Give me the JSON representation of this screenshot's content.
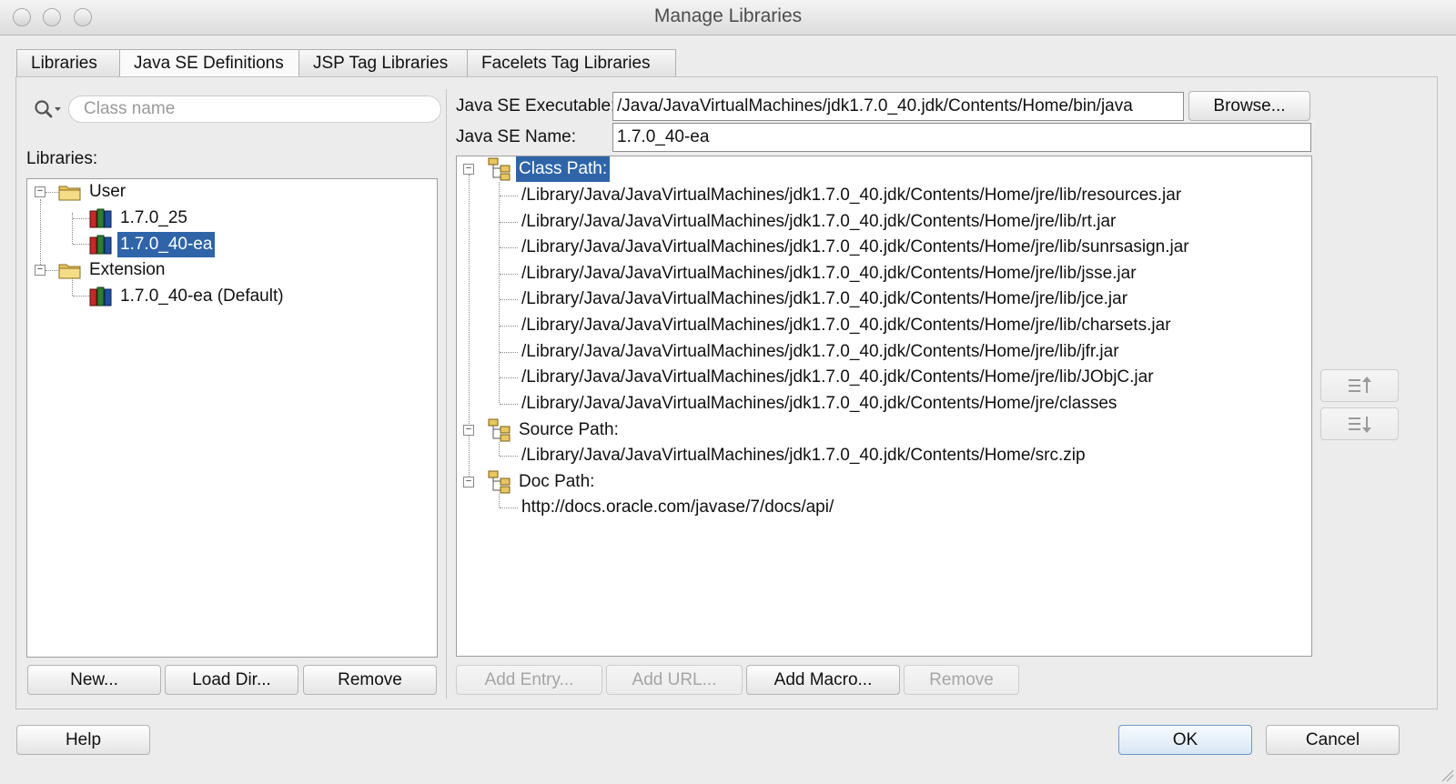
{
  "window": {
    "title": "Manage Libraries"
  },
  "tabs": [
    {
      "label": "Libraries"
    },
    {
      "label": "Java SE Definitions"
    },
    {
      "label": "JSP Tag Libraries"
    },
    {
      "label": "Facelets Tag Libraries"
    }
  ],
  "active_tab": "Java SE Definitions",
  "search": {
    "placeholder": "Class name",
    "value": ""
  },
  "libraries": {
    "label": "Libraries:",
    "groups": [
      {
        "name": "User",
        "items": [
          "1.7.0_25",
          "1.7.0_40-ea"
        ]
      },
      {
        "name": "Extension",
        "items": [
          "1.7.0_40-ea (Default)"
        ]
      }
    ],
    "selected": "1.7.0_40-ea",
    "buttons": {
      "new": "New...",
      "load_dir": "Load Dir...",
      "remove": "Remove"
    }
  },
  "definition": {
    "executable_label": "Java SE Executable:",
    "executable_value": "/Java/JavaVirtualMachines/jdk1.7.0_40.jdk/Contents/Home/bin/java",
    "browse_label": "Browse...",
    "name_label": "Java SE Name:",
    "name_value": "1.7.0_40-ea"
  },
  "paths": {
    "class_path": {
      "label": "Class Path:",
      "entries": [
        "/Library/Java/JavaVirtualMachines/jdk1.7.0_40.jdk/Contents/Home/jre/lib/resources.jar",
        "/Library/Java/JavaVirtualMachines/jdk1.7.0_40.jdk/Contents/Home/jre/lib/rt.jar",
        "/Library/Java/JavaVirtualMachines/jdk1.7.0_40.jdk/Contents/Home/jre/lib/sunrsasign.jar",
        "/Library/Java/JavaVirtualMachines/jdk1.7.0_40.jdk/Contents/Home/jre/lib/jsse.jar",
        "/Library/Java/JavaVirtualMachines/jdk1.7.0_40.jdk/Contents/Home/jre/lib/jce.jar",
        "/Library/Java/JavaVirtualMachines/jdk1.7.0_40.jdk/Contents/Home/jre/lib/charsets.jar",
        "/Library/Java/JavaVirtualMachines/jdk1.7.0_40.jdk/Contents/Home/jre/lib/jfr.jar",
        "/Library/Java/JavaVirtualMachines/jdk1.7.0_40.jdk/Contents/Home/jre/lib/JObjC.jar",
        "/Library/Java/JavaVirtualMachines/jdk1.7.0_40.jdk/Contents/Home/jre/classes"
      ]
    },
    "source_path": {
      "label": "Source Path:",
      "entries": [
        "/Library/Java/JavaVirtualMachines/jdk1.7.0_40.jdk/Contents/Home/src.zip"
      ]
    },
    "doc_path": {
      "label": "Doc Path:",
      "entries": [
        "http://docs.oracle.com/javase/7/docs/api/"
      ]
    },
    "selected": "Class Path:",
    "buttons": {
      "add_entry": "Add Entry...",
      "add_url": "Add URL...",
      "add_macro": "Add Macro...",
      "remove": "Remove"
    }
  },
  "footer": {
    "help": "Help",
    "ok": "OK",
    "cancel": "Cancel"
  },
  "colors": {
    "selection": "#2f65a8",
    "window_bg": "#ececec"
  },
  "icons": [
    "search-icon",
    "folder-icon",
    "library-icon",
    "path-node-icon",
    "move-up-icon",
    "move-down-icon"
  ]
}
